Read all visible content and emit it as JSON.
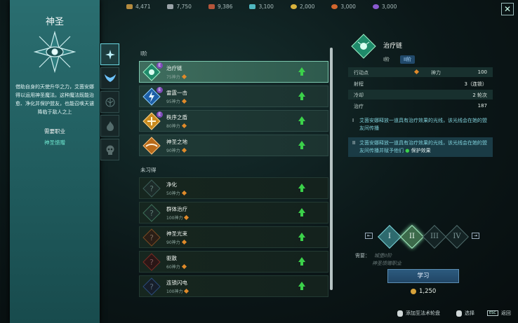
{
  "resources": [
    {
      "value": "4,471",
      "color": "#b48a3e"
    },
    {
      "value": "7,750",
      "color": "#9aa3a8"
    },
    {
      "value": "9,386",
      "color": "#b4553a"
    },
    {
      "value": "3,100",
      "color": "#4fb7c0"
    },
    {
      "value": "2,000",
      "color": "#d8b23c"
    },
    {
      "value": "3,000",
      "color": "#d2662e"
    },
    {
      "value": "3,000",
      "color": "#8a5ad0"
    }
  ],
  "close_label": "✕",
  "class_panel": {
    "title": "神圣",
    "description": "借助自身的天使升华之力，艾茵安娜得以运用神圣魔法。这种魔法既能治愈、净化并保护盟友，也能召唤天谴降临于敌人之上",
    "requirement_label": "需要职业",
    "requirement_value": "神圣馈赠"
  },
  "list": {
    "section_learned": "I阶",
    "section_unlearned": "未习得",
    "learned": [
      {
        "name": "治疗链",
        "cost": "75神力"
      },
      {
        "name": "雷霆一击",
        "cost": "95神力"
      },
      {
        "name": "秩序之盾",
        "cost": "80神力"
      },
      {
        "name": "神圣之地",
        "cost": "90神力"
      }
    ],
    "unlearned": [
      {
        "name": "净化",
        "cost": "50神力"
      },
      {
        "name": "群体治疗",
        "cost": "100神力"
      },
      {
        "name": "神圣光束",
        "cost": "90神力"
      },
      {
        "name": "驱散",
        "cost": "60神力"
      },
      {
        "name": "连锁闪电",
        "cost": "100神力"
      }
    ],
    "badge": "E"
  },
  "detail": {
    "name": "治疗链",
    "tier_a": "I阶",
    "tier_b": "II阶",
    "stats": {
      "action_label": "行动点",
      "mana_label": "神力",
      "mana_value": "100",
      "range_label": "射程",
      "range_value": "3（连锁）",
      "cooldown_label": "冷却",
      "cooldown_value": "2 轮次",
      "heal_label": "治疗",
      "heal_value": "187"
    },
    "tier1_num": "I",
    "tier1_text": "艾茵安娜释放一道具有治疗效果的光线，该光线会在她的盟友间传播",
    "tier2_num": "II",
    "tier2_text": "艾茵安娜释放一道具有治疗效果的光线，该光线会在她的盟友间传播并赋予他们",
    "tier2_effect": "保护效果"
  },
  "tiers": [
    "I",
    "II",
    "III",
    "IV"
  ],
  "requirements": {
    "label": "需要：",
    "line1": "城堡II阶",
    "line2": "神圣馈赠职业"
  },
  "learn_button": "学习",
  "gold": "1,250",
  "hints": {
    "add": "添加至法术轮盘",
    "select": "选择",
    "esc": "ESC",
    "back": "返回"
  }
}
